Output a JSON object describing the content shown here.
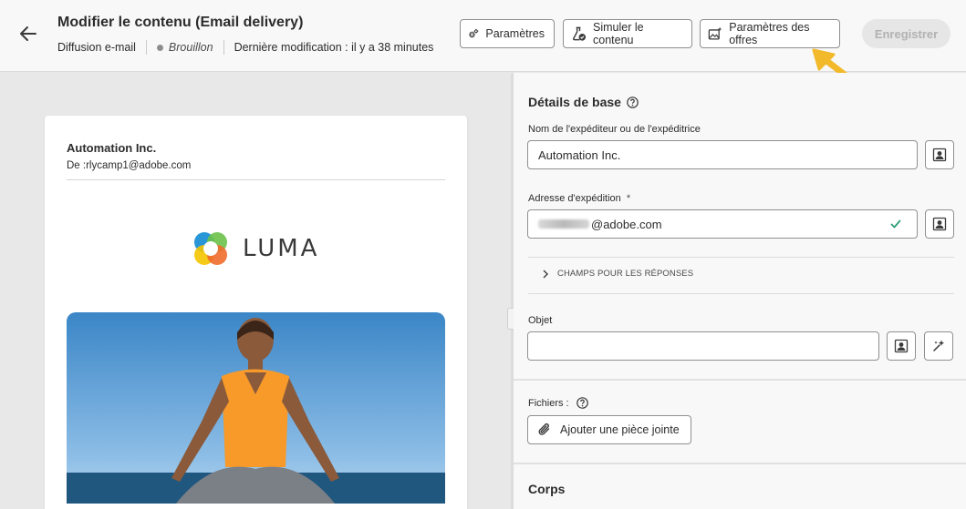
{
  "header": {
    "title": "Modifier le contenu (Email delivery)",
    "channel": "Diffusion e-mail",
    "status": "Brouillon",
    "last_modified": "Dernière modification : il y a 38 minutes",
    "buttons": {
      "settings": "Paramètres",
      "simulate": "Simuler le contenu",
      "offers": "Paramètres des offres",
      "save": "Enregistrer"
    }
  },
  "preview": {
    "sender_name": "Automation Inc.",
    "from": "De :rlycamp1@adobe.com",
    "brand": "LUMA"
  },
  "panel": {
    "basic_title": "Détails de base",
    "sender_label": "Nom de l'expéditeur ou de l'expéditrice",
    "sender_value": "Automation Inc.",
    "address_label": "Adresse d'expédition",
    "required_mark": "*",
    "address_value": "@adobe.com",
    "reply_fields": "CHAMPS POUR LES RÉPONSES",
    "subject_label": "Objet",
    "subject_value": "",
    "files_label": "Fichiers :",
    "attach_label": "Ajouter une pièce jointe",
    "body_title": "Corps"
  },
  "colors": {
    "accent_check": "#2d9d78",
    "arrow": "#f2b92b",
    "save_disabled_bg": "#e6e6e6"
  }
}
